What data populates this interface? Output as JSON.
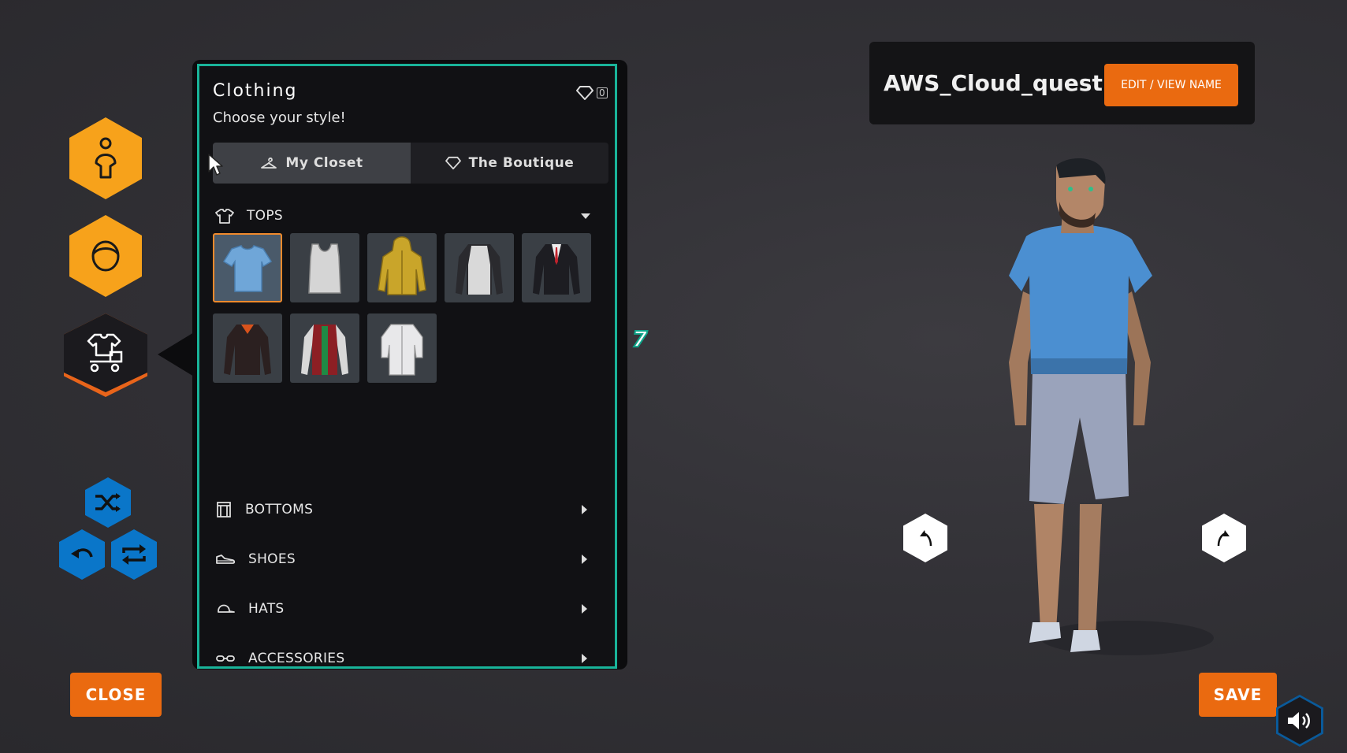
{
  "panel": {
    "title": "Clothing",
    "subtitle": "Choose your style!",
    "gem_count": "0",
    "tabs": [
      {
        "label": "My Closet",
        "icon": "hanger-icon"
      },
      {
        "label": "The Boutique",
        "icon": "diamond-icon"
      }
    ],
    "categories": {
      "tops": "TOPS",
      "bottoms": "BOTTOMS",
      "shoes": "SHOES",
      "hats": "HATS",
      "accessories": "ACCESSORIES"
    },
    "tops_items": [
      {
        "name": "blue-tshirt",
        "color": "#6fa6d8"
      },
      {
        "name": "white-tank",
        "color": "#d5d5d5"
      },
      {
        "name": "yellow-hoodie",
        "color": "#c9a52a"
      },
      {
        "name": "raglan-longsleeve",
        "color": "#2a2a2e"
      },
      {
        "name": "black-suit-jacket",
        "color": "#1d1d22"
      },
      {
        "name": "black-orange-jacket",
        "color": "#2b2020"
      },
      {
        "name": "red-green-jacket",
        "color": "#8c1f24"
      },
      {
        "name": "white-shirt",
        "color": "#e8e8ea"
      }
    ]
  },
  "badge_number": "7",
  "character": {
    "name": "AWS_Cloud_quest",
    "edit_label": "EDIT / VIEW NAME"
  },
  "buttons": {
    "close": "CLOSE",
    "save": "SAVE"
  },
  "colors": {
    "accent_orange": "#ea6a10",
    "hex_orange": "#f7a21b",
    "hex_blue": "#0a76c9",
    "panel_border": "#19b49a"
  }
}
